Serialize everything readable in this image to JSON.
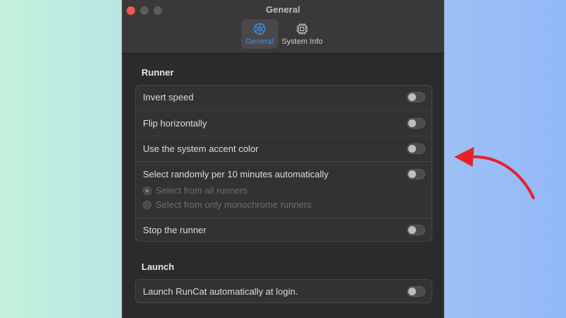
{
  "window": {
    "title": "General",
    "tabs": [
      {
        "label": "General",
        "icon": "gear-icon",
        "selected": true
      },
      {
        "label": "System Info",
        "icon": "chip-icon",
        "selected": false
      }
    ]
  },
  "runner": {
    "title": "Runner",
    "invert_speed": {
      "label": "Invert speed",
      "on": false
    },
    "flip_horizontally": {
      "label": "Flip horizontally",
      "on": false
    },
    "system_accent": {
      "label": "Use the system accent color",
      "on": false
    },
    "select_randomly": {
      "label": "Select randomly per 10 minutes automatically",
      "on": false,
      "options": [
        {
          "label": "Select from all runners",
          "selected": true
        },
        {
          "label": "Select from only monochrome runners",
          "selected": false
        }
      ]
    },
    "stop_runner": {
      "label": "Stop the runner",
      "on": false
    }
  },
  "launch": {
    "title": "Launch",
    "launch_at_login": {
      "label": "Launch RunCat automatically at login.",
      "on": false
    }
  },
  "colors": {
    "accent": "#3d8ef0",
    "close": "#ee5a52",
    "annotation_arrow": "#e8202a"
  }
}
